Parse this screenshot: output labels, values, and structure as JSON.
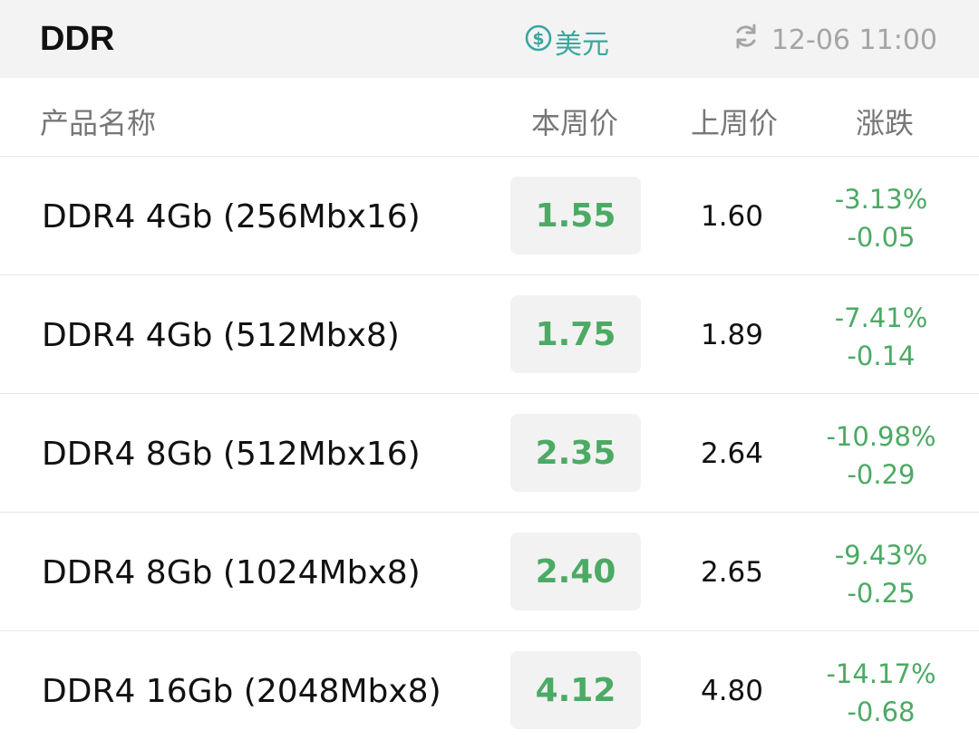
{
  "header": {
    "title": "DDR",
    "currency_label": "美元",
    "currency_icon": "dollar-circle-icon",
    "refresh_icon": "refresh-icon",
    "updated_time": "12-06 11:00"
  },
  "columns": {
    "name": "产品名称",
    "current": "本周价",
    "previous": "上周价",
    "change": "涨跌"
  },
  "colors": {
    "accent_teal": "#3aa6a0",
    "price_green": "#4caa64",
    "muted_gray": "#a5a5a5"
  },
  "rows": [
    {
      "name": "DDR4 4Gb (256Mbx16)",
      "current": "1.55",
      "previous": "1.60",
      "change_pct": "-3.13%",
      "change_abs": "-0.05"
    },
    {
      "name": "DDR4 4Gb (512Mbx8)",
      "current": "1.75",
      "previous": "1.89",
      "change_pct": "-7.41%",
      "change_abs": "-0.14"
    },
    {
      "name": "DDR4 8Gb (512Mbx16)",
      "current": "2.35",
      "previous": "2.64",
      "change_pct": "-10.98%",
      "change_abs": "-0.29"
    },
    {
      "name": "DDR4 8Gb (1024Mbx8)",
      "current": "2.40",
      "previous": "2.65",
      "change_pct": "-9.43%",
      "change_abs": "-0.25"
    },
    {
      "name": "DDR4 16Gb (2048Mbx8)",
      "current": "4.12",
      "previous": "4.80",
      "change_pct": "-14.17%",
      "change_abs": "-0.68"
    }
  ]
}
